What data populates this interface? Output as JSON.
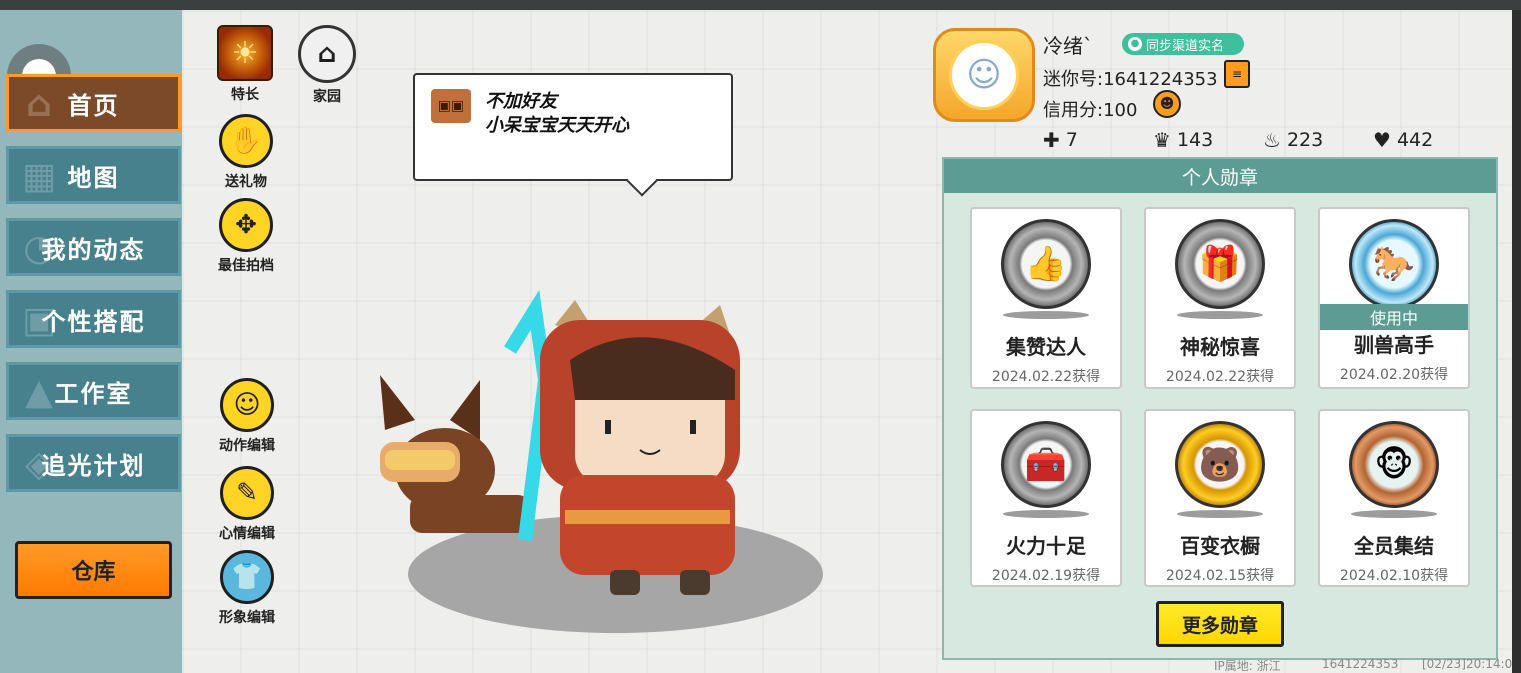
{
  "sidebar": {
    "items": [
      {
        "label": "首页",
        "icon": "home-icon",
        "active": true
      },
      {
        "label": "地图",
        "icon": "map-icon",
        "active": false
      },
      {
        "label": "我的动态",
        "icon": "bell-icon",
        "active": false
      },
      {
        "label": "个性搭配",
        "icon": "outfit-icon",
        "active": false
      },
      {
        "label": "工作室",
        "icon": "tree-icon",
        "active": false
      },
      {
        "label": "追光计划",
        "icon": "light-icon",
        "active": false
      }
    ],
    "warehouse_label": "仓库"
  },
  "actions": {
    "specialty": "特长",
    "homeland": "家园",
    "send_gift": "送礼物",
    "best_partner": "最佳拍档",
    "action_edit": "动作编辑",
    "mood_edit": "心情编辑",
    "image_edit": "形象编辑"
  },
  "bubble": {
    "line1": "不加好友",
    "line2": "小呆宝宝天天开心"
  },
  "profile": {
    "name": "冷绪`",
    "sync_badge": "同步渠道实名",
    "mini_id": "迷你号:1641224353",
    "credit": "信用分:100",
    "stats": [
      {
        "icon": "bookmark-plus-icon",
        "value": "7"
      },
      {
        "icon": "trophy-icon",
        "value": "143"
      },
      {
        "icon": "flame-icon",
        "value": "223"
      },
      {
        "icon": "heart-icon",
        "value": "442"
      }
    ]
  },
  "badges": {
    "header": "个人勋章",
    "in_use_label": "使用中",
    "more_button": "更多勋章",
    "items": [
      {
        "title": "集赞达人",
        "date": "2024.02.22获得",
        "style": "silver",
        "glyph": "👍",
        "in_use": false
      },
      {
        "title": "神秘惊喜",
        "date": "2024.02.22获得",
        "style": "silver",
        "glyph": "🎁",
        "in_use": false
      },
      {
        "title": "驯兽高手",
        "date": "2024.02.20获得",
        "style": "blue",
        "glyph": "🐎",
        "in_use": true
      },
      {
        "title": "火力十足",
        "date": "2024.02.19获得",
        "style": "silver",
        "glyph": "🧰",
        "in_use": false
      },
      {
        "title": "百变衣橱",
        "date": "2024.02.15获得",
        "style": "gold",
        "glyph": "🐻",
        "in_use": false
      },
      {
        "title": "全员集结",
        "date": "2024.02.10获得",
        "style": "bronze",
        "glyph": "🐵",
        "in_use": false
      }
    ]
  },
  "footer": {
    "ip": "IP属地: 浙江",
    "id": "1641224353",
    "time": "[02/23]20:14:0"
  },
  "colors": {
    "active_tab": "#7c4a28",
    "active_border": "#ff9a2a",
    "tab_bg": "#47818e",
    "accent_yellow": "#ffd424",
    "panel_header": "#5c9c95"
  }
}
